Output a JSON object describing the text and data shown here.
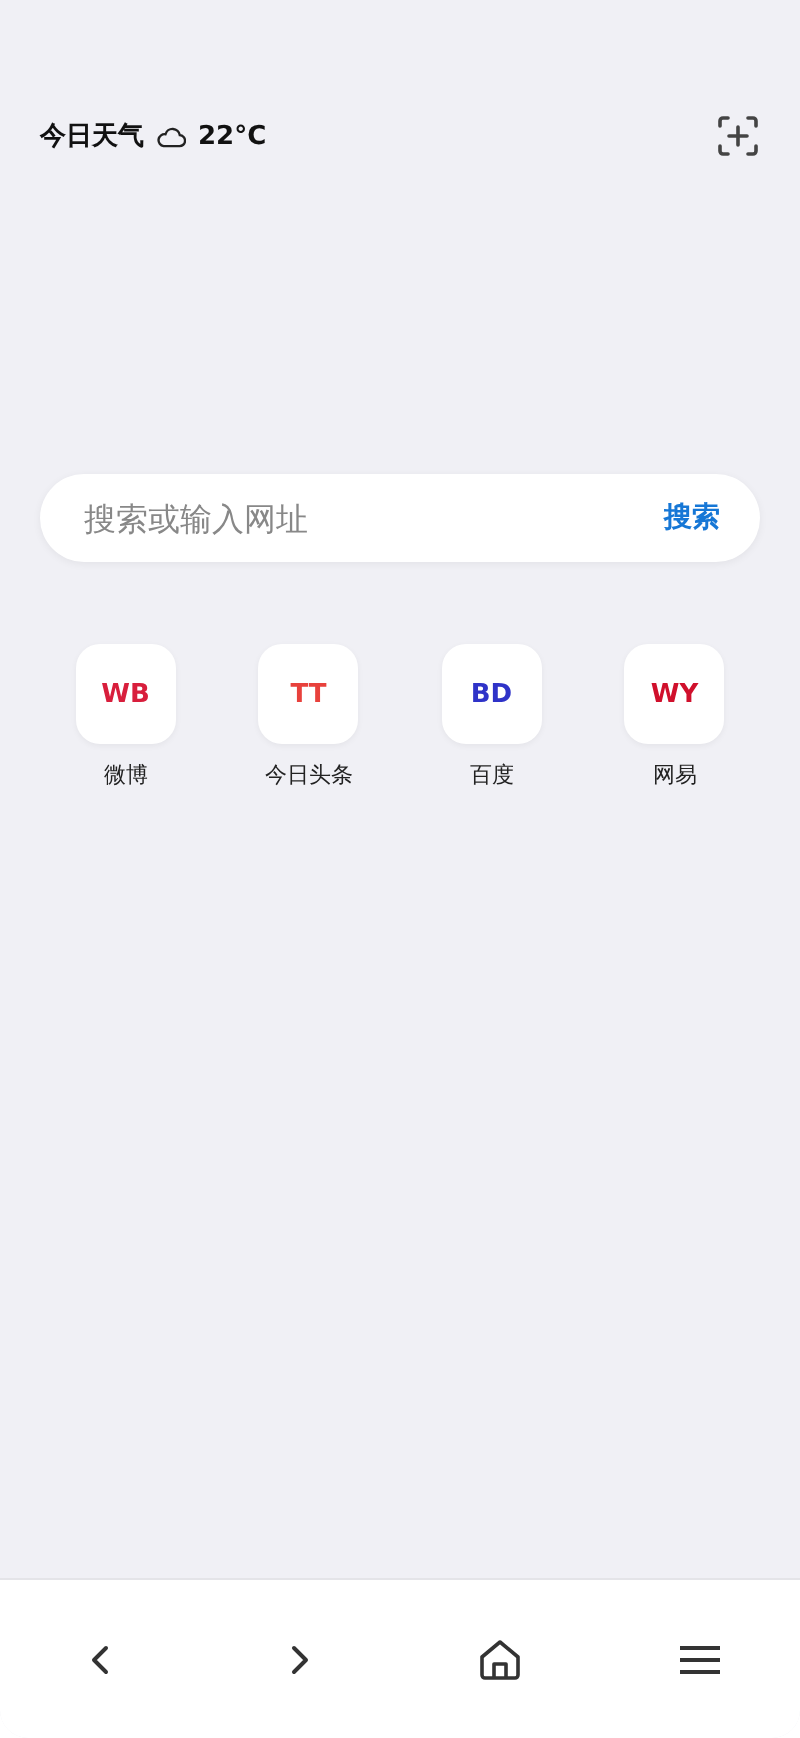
{
  "weather": {
    "label": "今日天气",
    "temperature": "22°C"
  },
  "search": {
    "placeholder": "搜索或输入网址",
    "button": "搜索"
  },
  "shortcuts": [
    {
      "badge": "WB",
      "label": "微博",
      "color": "#d81e3c"
    },
    {
      "badge": "TT",
      "label": "今日头条",
      "color": "#e8413c"
    },
    {
      "badge": "BD",
      "label": "百度",
      "color": "#2f33c8"
    },
    {
      "badge": "WY",
      "label": "网易",
      "color": "#d0102c"
    }
  ],
  "nav": [
    {
      "kind": "back"
    },
    {
      "kind": "forward"
    },
    {
      "kind": "home"
    },
    {
      "kind": "menu"
    }
  ]
}
